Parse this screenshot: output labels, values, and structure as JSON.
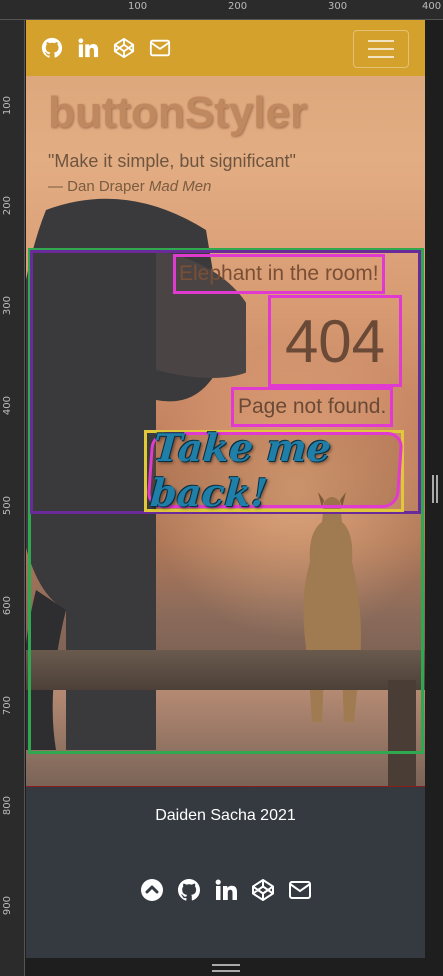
{
  "ruler": {
    "top_labels": [
      "100",
      "200",
      "300",
      "400"
    ],
    "left_labels": [
      "100",
      "200",
      "300",
      "400",
      "500",
      "600",
      "700",
      "800",
      "900"
    ]
  },
  "nav": {
    "icons": [
      "github-icon",
      "linkedin-icon",
      "codepen-icon",
      "mail-icon"
    ],
    "menu_icon": "hamburger-menu-icon",
    "color": "#d4a12c"
  },
  "hero": {
    "brand": "buttonStyler",
    "quote": "\"Make it simple, but significant\"",
    "attribution_prefix": "— Dan Draper",
    "attribution_source": "Mad Men"
  },
  "error": {
    "tagline": "Elephant in the room!",
    "code": "404",
    "message": "Page not found.",
    "back_button": "Take me back!"
  },
  "footer": {
    "credit": "Daiden Sacha 2021",
    "icons": [
      "chevron-up-circle-icon",
      "github-icon",
      "linkedin-icon",
      "codepen-icon",
      "mail-icon"
    ],
    "background": "#343a40"
  }
}
